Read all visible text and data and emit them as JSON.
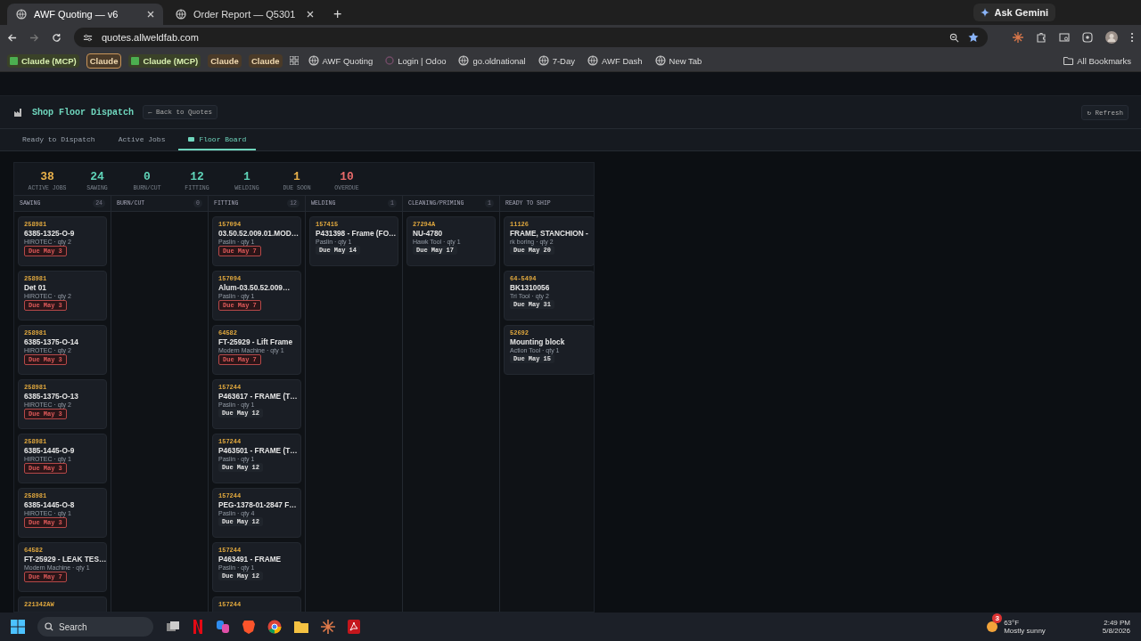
{
  "browser": {
    "tabs": [
      {
        "title": "AWF Quoting — v6",
        "selected": true
      },
      {
        "title": "Order Report — Q5301",
        "selected": false
      }
    ],
    "new_tab": "+",
    "url": "quotes.allweldfab.com",
    "ask_gemini": "Ask Gemini",
    "bookmarks": [
      {
        "label": "Claude (MCP)",
        "kind": "check"
      },
      {
        "label": "Claude",
        "kind": "outlined"
      },
      {
        "label": "Claude (MCP)",
        "kind": "check"
      },
      {
        "label": "Claude",
        "kind": "chip"
      },
      {
        "label": "Claude",
        "kind": "chip"
      },
      {
        "label": "AWF Quoting",
        "kind": "globe"
      },
      {
        "label": "Login | Odoo",
        "kind": "ring"
      },
      {
        "label": "go.oldnational",
        "kind": "globe"
      },
      {
        "label": "7-Day",
        "kind": "globe"
      },
      {
        "label": "AWF Dash",
        "kind": "globe"
      },
      {
        "label": "New Tab",
        "kind": "globe"
      }
    ],
    "all_bookmarks": "All Bookmarks"
  },
  "app": {
    "title": "Shop Floor Dispatch",
    "back": "← Back to Quotes",
    "refresh": "↻ Refresh",
    "tabs": [
      {
        "label": "Ready to Dispatch",
        "selected": false
      },
      {
        "label": "Active Jobs",
        "selected": false
      },
      {
        "label": "Floor Board",
        "selected": true
      }
    ],
    "stats": [
      {
        "value": "38",
        "label": "ACTIVE JOBS",
        "color": "#e8b04a"
      },
      {
        "value": "24",
        "label": "SAWING",
        "color": "#5fd3b8"
      },
      {
        "value": "0",
        "label": "BURN/CUT",
        "color": "#5fd3b8"
      },
      {
        "value": "12",
        "label": "FITTING",
        "color": "#5fd3b8"
      },
      {
        "value": "1",
        "label": "WELDING",
        "color": "#5fd3b8"
      },
      {
        "value": "1",
        "label": "DUE SOON",
        "color": "#e8b04a"
      },
      {
        "value": "10",
        "label": "OVERDUE",
        "color": "#e86a6a"
      }
    ],
    "columns": [
      {
        "title": "SAWING",
        "count": "24",
        "cards": [
          {
            "job": "258981",
            "title": "6385-1325-O-9",
            "meta": "HIROTEC · qty 2",
            "due": "Due May 3",
            "overdue": true
          },
          {
            "job": "258981",
            "title": "Det 01",
            "meta": "HIROTEC · qty 2",
            "due": "Due May 3",
            "overdue": true
          },
          {
            "job": "258981",
            "title": "6385-1375-O-14",
            "meta": "HIROTEC · qty 2",
            "due": "Due May 3",
            "overdue": true
          },
          {
            "job": "258981",
            "title": "6385-1375-O-13",
            "meta": "HIROTEC · qty 2",
            "due": "Due May 3",
            "overdue": true
          },
          {
            "job": "258981",
            "title": "6385-1445-O-9",
            "meta": "HIROTEC · qty 1",
            "due": "Due May 3",
            "overdue": true
          },
          {
            "job": "258981",
            "title": "6385-1445-O-8",
            "meta": "HIROTEC · qty 1",
            "due": "Due May 3",
            "overdue": true
          },
          {
            "job": "64582",
            "title": "FT-25929 - LEAK TES…",
            "meta": "Modern Machine · qty 1",
            "due": "Due May 7",
            "overdue": true
          },
          {
            "job": "221342AW"
          }
        ]
      },
      {
        "title": "BURN/CUT",
        "count": "0"
      },
      {
        "title": "FITTING",
        "count": "12",
        "cards": [
          {
            "job": "157094",
            "title": "03.50.52.009.01.MOD…",
            "meta": "Paslin · qty 1",
            "due": "Due May 7",
            "overdue": true
          },
          {
            "job": "157094",
            "title": "Alum-03.50.52.009…",
            "meta": "Paslin · qty 1",
            "due": "Due May 7",
            "overdue": true
          },
          {
            "job": "64582",
            "title": "FT-25929 - Lift Frame",
            "meta": "Modern Machine · qty 1",
            "due": "Due May 7",
            "overdue": true
          },
          {
            "job": "157244",
            "title": "P463617 - FRAME (T…",
            "meta": "Paslin · qty 1",
            "due": "Due May 12",
            "overdue": false
          },
          {
            "job": "157244",
            "title": "P463501 - FRAME (T…",
            "meta": "Paslin · qty 1",
            "due": "Due May 12",
            "overdue": false
          },
          {
            "job": "157244",
            "title": "PEG-1378-01-2847 F…",
            "meta": "Paslin · qty 4",
            "due": "Due May 12",
            "overdue": false
          },
          {
            "job": "157244",
            "title": "P463491 - FRAME",
            "meta": "Paslin · qty 1",
            "due": "Due May 12",
            "overdue": false
          },
          {
            "job": "157244"
          }
        ]
      },
      {
        "title": "WELDING",
        "count": "1",
        "cards": [
          {
            "job": "157415",
            "title": "P431398 - Frame (FO…",
            "meta": "Paslin · qty 1",
            "due": "Due May 14",
            "overdue": false
          }
        ]
      },
      {
        "title": "CLEANING/PRIMING",
        "count": "1",
        "cards": [
          {
            "job": "27294A",
            "title": "NU-4780",
            "meta": "Hawk Tool · qty 1",
            "due": "Due May 17",
            "overdue": false
          }
        ]
      },
      {
        "title": "READY TO SHIP",
        "cards": [
          {
            "job": "11126",
            "title": "FRAME, STANCHION -",
            "meta": "rk boring · qty 2",
            "due": "Due May 20",
            "overdue": false
          },
          {
            "job": "64-5494",
            "title": "BK1310056",
            "meta": "Tri Tool · qty 2",
            "due": "Due May 31",
            "overdue": false
          },
          {
            "job": "52692",
            "title": "Mounting block",
            "meta": "Action Tool · qty 1",
            "due": "Due May 15",
            "overdue": false
          }
        ]
      }
    ]
  },
  "taskbar": {
    "search": "Search",
    "weather_badge": "3",
    "temperature": "63°F",
    "condition": "Mostly sunny",
    "time": "2:49 PM",
    "date": "5/8/2026"
  }
}
